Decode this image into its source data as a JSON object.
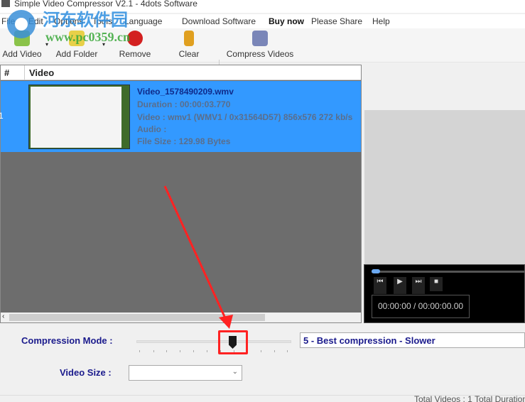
{
  "title": "Simple Video Compressor V2.1 - 4dots Software",
  "menu": [
    "File",
    "Edit",
    "Options",
    "Tools",
    "Language",
    "Download Software",
    "Buy now",
    "Please Share",
    "Help"
  ],
  "toolbar": {
    "add_video": "Add Video",
    "add_folder": "Add Folder",
    "remove": "Remove",
    "clear": "Clear",
    "compress": "Compress Videos"
  },
  "list": {
    "col_num": "#",
    "col_video": "Video",
    "rows": [
      {
        "num": "1",
        "name": "Video_1578490209.wmv",
        "duration": "Duration : 00:00:03.770",
        "video": "Video : wmv1 (WMV1 / 0x31564D57) 856x576 272 kb/s",
        "audio": "Audio :",
        "size": "File Size : 129.98 Bytes"
      }
    ]
  },
  "player": {
    "time": "00:00:00 / 00:00:00.00"
  },
  "settings": {
    "compression_label": "Compression Mode :",
    "compression_value": 5,
    "compression_text": "5 - Best compression - Slower",
    "video_size_label": "Video Size :",
    "video_size_value": ""
  },
  "status": "Total Videos : 1  Total Duration",
  "watermark": {
    "cn": "河东软件园",
    "url": "www.pc0359.cn"
  },
  "colors": {
    "selection": "#3399ff",
    "label": "#1a1a8c",
    "annotation": "#ff2222"
  }
}
